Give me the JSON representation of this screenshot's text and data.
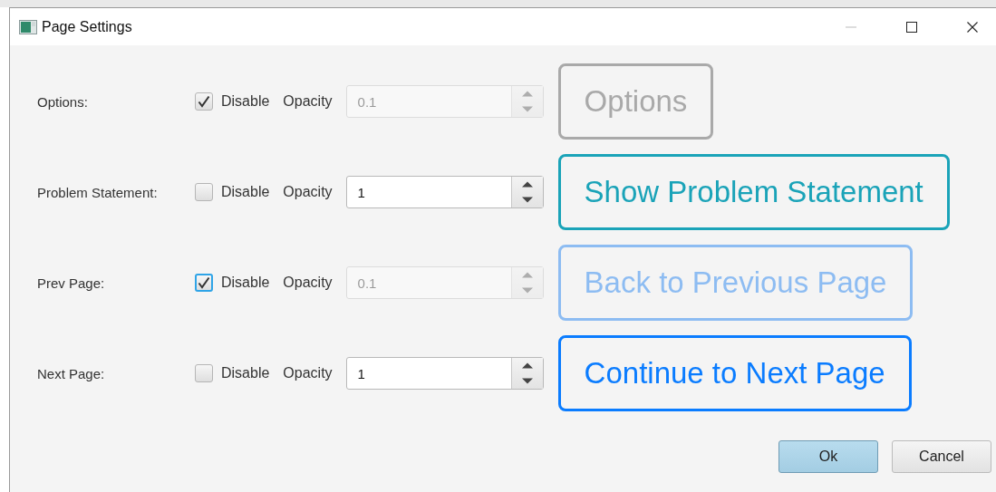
{
  "window": {
    "title": "Page Settings"
  },
  "rows": [
    {
      "label": "Options:",
      "disable_label": "Disable",
      "checked": true,
      "focused": false,
      "opacity_label": "Opacity",
      "opacity_value": "0.1",
      "preview_button": "Options",
      "color": "#a9a9a9"
    },
    {
      "label": "Problem Statement:",
      "disable_label": "Disable",
      "checked": false,
      "focused": false,
      "opacity_label": "Opacity",
      "opacity_value": "1",
      "preview_button": "Show Problem Statement",
      "color": "#1aa3b8"
    },
    {
      "label": "Prev Page:",
      "disable_label": "Disable",
      "checked": true,
      "focused": true,
      "opacity_label": "Opacity",
      "opacity_value": "0.1",
      "preview_button": "Back to Previous Page",
      "color": "#8dbcf2"
    },
    {
      "label": "Next Page:",
      "disable_label": "Disable",
      "checked": false,
      "focused": false,
      "opacity_label": "Opacity",
      "opacity_value": "1",
      "preview_button": "Continue to Next Page",
      "color": "#0a7cff"
    }
  ],
  "buttons": [
    {
      "label": "Ok",
      "kind": "default"
    },
    {
      "label": "Cancel",
      "kind": "normal"
    }
  ]
}
